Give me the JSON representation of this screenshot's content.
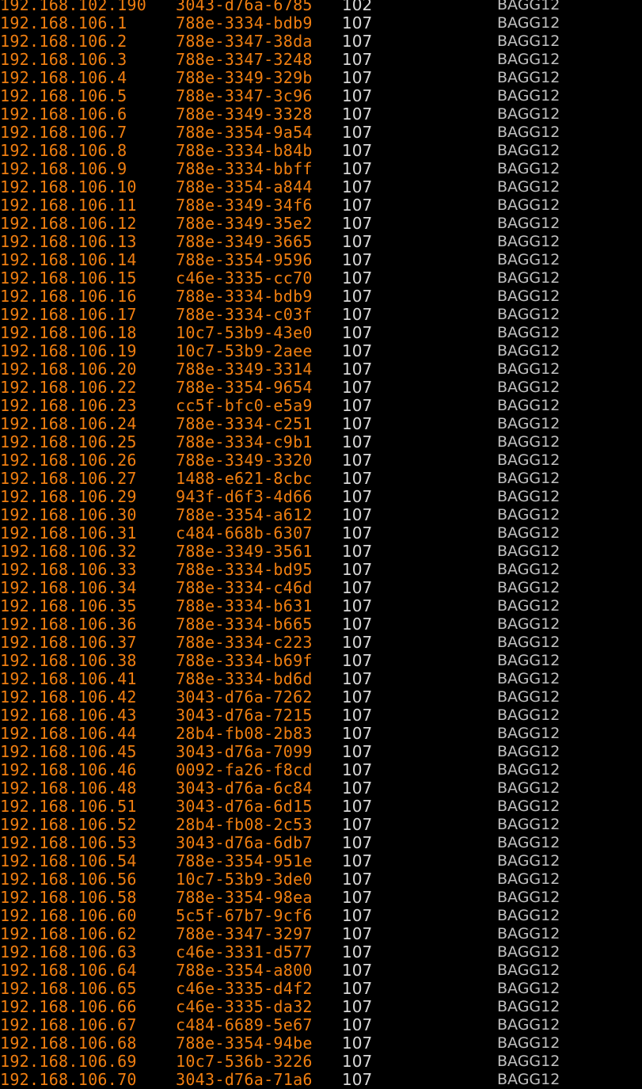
{
  "terminal": {
    "colors": {
      "address": "#f07e10",
      "vlan": "#d9d9d9",
      "port": "#c0c0c0",
      "background": "#000000"
    },
    "rows": [
      {
        "ip": "192.168.102.190",
        "mac": "3043-d76a-6785",
        "vlan": "102",
        "port": "BAGG12"
      },
      {
        "ip": "192.168.106.1",
        "mac": "788e-3334-bdb9",
        "vlan": "107",
        "port": "BAGG12"
      },
      {
        "ip": "192.168.106.2",
        "mac": "788e-3347-38da",
        "vlan": "107",
        "port": "BAGG12"
      },
      {
        "ip": "192.168.106.3",
        "mac": "788e-3347-3248",
        "vlan": "107",
        "port": "BAGG12"
      },
      {
        "ip": "192.168.106.4",
        "mac": "788e-3349-329b",
        "vlan": "107",
        "port": "BAGG12"
      },
      {
        "ip": "192.168.106.5",
        "mac": "788e-3347-3c96",
        "vlan": "107",
        "port": "BAGG12"
      },
      {
        "ip": "192.168.106.6",
        "mac": "788e-3349-3328",
        "vlan": "107",
        "port": "BAGG12"
      },
      {
        "ip": "192.168.106.7",
        "mac": "788e-3354-9a54",
        "vlan": "107",
        "port": "BAGG12"
      },
      {
        "ip": "192.168.106.8",
        "mac": "788e-3334-b84b",
        "vlan": "107",
        "port": "BAGG12"
      },
      {
        "ip": "192.168.106.9",
        "mac": "788e-3334-bbff",
        "vlan": "107",
        "port": "BAGG12"
      },
      {
        "ip": "192.168.106.10",
        "mac": "788e-3354-a844",
        "vlan": "107",
        "port": "BAGG12"
      },
      {
        "ip": "192.168.106.11",
        "mac": "788e-3349-34f6",
        "vlan": "107",
        "port": "BAGG12"
      },
      {
        "ip": "192.168.106.12",
        "mac": "788e-3349-35e2",
        "vlan": "107",
        "port": "BAGG12"
      },
      {
        "ip": "192.168.106.13",
        "mac": "788e-3349-3665",
        "vlan": "107",
        "port": "BAGG12"
      },
      {
        "ip": "192.168.106.14",
        "mac": "788e-3354-9596",
        "vlan": "107",
        "port": "BAGG12"
      },
      {
        "ip": "192.168.106.15",
        "mac": "c46e-3335-cc70",
        "vlan": "107",
        "port": "BAGG12"
      },
      {
        "ip": "192.168.106.16",
        "mac": "788e-3334-bdb9",
        "vlan": "107",
        "port": "BAGG12"
      },
      {
        "ip": "192.168.106.17",
        "mac": "788e-3334-c03f",
        "vlan": "107",
        "port": "BAGG12"
      },
      {
        "ip": "192.168.106.18",
        "mac": "10c7-53b9-43e0",
        "vlan": "107",
        "port": "BAGG12"
      },
      {
        "ip": "192.168.106.19",
        "mac": "10c7-53b9-2aee",
        "vlan": "107",
        "port": "BAGG12"
      },
      {
        "ip": "192.168.106.20",
        "mac": "788e-3349-3314",
        "vlan": "107",
        "port": "BAGG12"
      },
      {
        "ip": "192.168.106.22",
        "mac": "788e-3354-9654",
        "vlan": "107",
        "port": "BAGG12"
      },
      {
        "ip": "192.168.106.23",
        "mac": "cc5f-bfc0-e5a9",
        "vlan": "107",
        "port": "BAGG12"
      },
      {
        "ip": "192.168.106.24",
        "mac": "788e-3334-c251",
        "vlan": "107",
        "port": "BAGG12"
      },
      {
        "ip": "192.168.106.25",
        "mac": "788e-3334-c9b1",
        "vlan": "107",
        "port": "BAGG12"
      },
      {
        "ip": "192.168.106.26",
        "mac": "788e-3349-3320",
        "vlan": "107",
        "port": "BAGG12"
      },
      {
        "ip": "192.168.106.27",
        "mac": "1488-e621-8cbc",
        "vlan": "107",
        "port": "BAGG12"
      },
      {
        "ip": "192.168.106.29",
        "mac": "943f-d6f3-4d66",
        "vlan": "107",
        "port": "BAGG12"
      },
      {
        "ip": "192.168.106.30",
        "mac": "788e-3354-a612",
        "vlan": "107",
        "port": "BAGG12"
      },
      {
        "ip": "192.168.106.31",
        "mac": "c484-668b-6307",
        "vlan": "107",
        "port": "BAGG12"
      },
      {
        "ip": "192.168.106.32",
        "mac": "788e-3349-3561",
        "vlan": "107",
        "port": "BAGG12"
      },
      {
        "ip": "192.168.106.33",
        "mac": "788e-3334-bd95",
        "vlan": "107",
        "port": "BAGG12"
      },
      {
        "ip": "192.168.106.34",
        "mac": "788e-3334-c46d",
        "vlan": "107",
        "port": "BAGG12"
      },
      {
        "ip": "192.168.106.35",
        "mac": "788e-3334-b631",
        "vlan": "107",
        "port": "BAGG12"
      },
      {
        "ip": "192.168.106.36",
        "mac": "788e-3334-b665",
        "vlan": "107",
        "port": "BAGG12"
      },
      {
        "ip": "192.168.106.37",
        "mac": "788e-3334-c223",
        "vlan": "107",
        "port": "BAGG12"
      },
      {
        "ip": "192.168.106.38",
        "mac": "788e-3334-b69f",
        "vlan": "107",
        "port": "BAGG12"
      },
      {
        "ip": "192.168.106.41",
        "mac": "788e-3334-bd6d",
        "vlan": "107",
        "port": "BAGG12"
      },
      {
        "ip": "192.168.106.42",
        "mac": "3043-d76a-7262",
        "vlan": "107",
        "port": "BAGG12"
      },
      {
        "ip": "192.168.106.43",
        "mac": "3043-d76a-7215",
        "vlan": "107",
        "port": "BAGG12"
      },
      {
        "ip": "192.168.106.44",
        "mac": "28b4-fb08-2b83",
        "vlan": "107",
        "port": "BAGG12"
      },
      {
        "ip": "192.168.106.45",
        "mac": "3043-d76a-7099",
        "vlan": "107",
        "port": "BAGG12"
      },
      {
        "ip": "192.168.106.46",
        "mac": "0092-fa26-f8cd",
        "vlan": "107",
        "port": "BAGG12"
      },
      {
        "ip": "192.168.106.48",
        "mac": "3043-d76a-6c84",
        "vlan": "107",
        "port": "BAGG12"
      },
      {
        "ip": "192.168.106.51",
        "mac": "3043-d76a-6d15",
        "vlan": "107",
        "port": "BAGG12"
      },
      {
        "ip": "192.168.106.52",
        "mac": "28b4-fb08-2c53",
        "vlan": "107",
        "port": "BAGG12"
      },
      {
        "ip": "192.168.106.53",
        "mac": "3043-d76a-6db7",
        "vlan": "107",
        "port": "BAGG12"
      },
      {
        "ip": "192.168.106.54",
        "mac": "788e-3354-951e",
        "vlan": "107",
        "port": "BAGG12"
      },
      {
        "ip": "192.168.106.56",
        "mac": "10c7-53b9-3de0",
        "vlan": "107",
        "port": "BAGG12"
      },
      {
        "ip": "192.168.106.58",
        "mac": "788e-3354-98ea",
        "vlan": "107",
        "port": "BAGG12"
      },
      {
        "ip": "192.168.106.60",
        "mac": "5c5f-67b7-9cf6",
        "vlan": "107",
        "port": "BAGG12"
      },
      {
        "ip": "192.168.106.62",
        "mac": "788e-3347-3297",
        "vlan": "107",
        "port": "BAGG12"
      },
      {
        "ip": "192.168.106.63",
        "mac": "c46e-3331-d577",
        "vlan": "107",
        "port": "BAGG12"
      },
      {
        "ip": "192.168.106.64",
        "mac": "788e-3354-a800",
        "vlan": "107",
        "port": "BAGG12"
      },
      {
        "ip": "192.168.106.65",
        "mac": "c46e-3335-d4f2",
        "vlan": "107",
        "port": "BAGG12"
      },
      {
        "ip": "192.168.106.66",
        "mac": "c46e-3335-da32",
        "vlan": "107",
        "port": "BAGG12"
      },
      {
        "ip": "192.168.106.67",
        "mac": "c484-6689-5e67",
        "vlan": "107",
        "port": "BAGG12"
      },
      {
        "ip": "192.168.106.68",
        "mac": "788e-3354-94be",
        "vlan": "107",
        "port": "BAGG12"
      },
      {
        "ip": "192.168.106.69",
        "mac": "10c7-536b-3226",
        "vlan": "107",
        "port": "BAGG12"
      },
      {
        "ip": "192.168.106.70",
        "mac": "3043-d76a-71a6",
        "vlan": "107",
        "port": "BAGG12"
      }
    ]
  }
}
